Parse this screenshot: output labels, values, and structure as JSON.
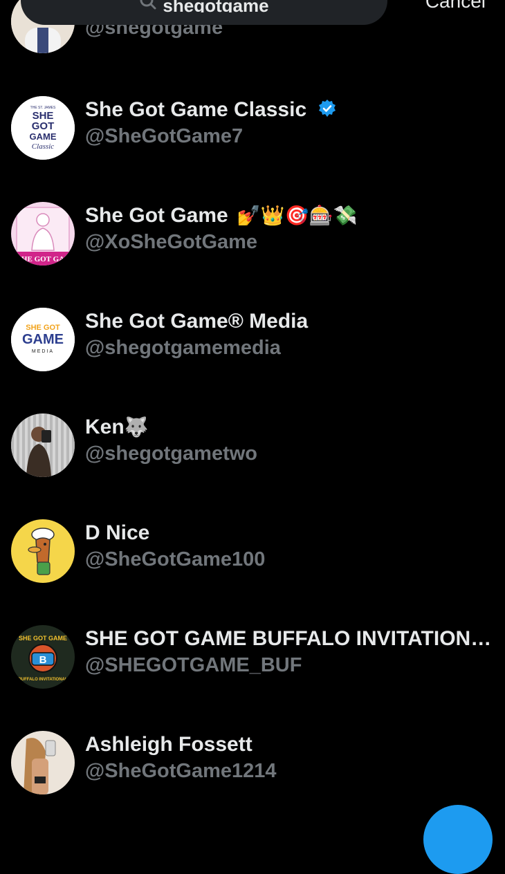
{
  "search": {
    "query": "shegotgame",
    "cancel_label": "Cancel"
  },
  "colors": {
    "accent": "#1d9bf0",
    "muted": "#71767b",
    "text": "#e7e9ea",
    "background": "#000000"
  },
  "results": [
    {
      "name": "",
      "handle": "@shegotgame",
      "avatar_icon": "woman-portrait-avatar"
    },
    {
      "name": "She Got Game Classic",
      "handle": "@SheGotGame7",
      "verified": true,
      "avatar_text": [
        "THE ST. JAMES",
        "SHE",
        "GOT",
        "GAME",
        "Classic"
      ]
    },
    {
      "name": "She Got Game",
      "emojis": "💅👑🎯🎰💸",
      "handle": "@XoSheGotGame",
      "avatar_text": [
        "HE GOT GA"
      ]
    },
    {
      "name": "She Got Game® Media",
      "handle": "@shegotgamemedia",
      "avatar_text": [
        "SHE GOT",
        "GAME",
        "MEDIA"
      ]
    },
    {
      "name": "Ken",
      "emojis": "🐺",
      "handle": "@shegotgametwo",
      "avatar_icon": "mirror-selfie-avatar"
    },
    {
      "name": "D Nice",
      "handle": "@SheGotGame100",
      "avatar_icon": "cartoon-duck-avatar"
    },
    {
      "name": "SHE GOT GAME BUFFALO INVITATION…",
      "handle": "@SHEGOTGAME_BUF",
      "avatar_text": [
        "SHE GOT GAME",
        "B",
        "BUFFALO INVITATIONAL"
      ]
    },
    {
      "name": "Ashleigh Fossett",
      "handle": "@SheGotGame1214",
      "avatar_icon": "selfie-avatar"
    }
  ]
}
